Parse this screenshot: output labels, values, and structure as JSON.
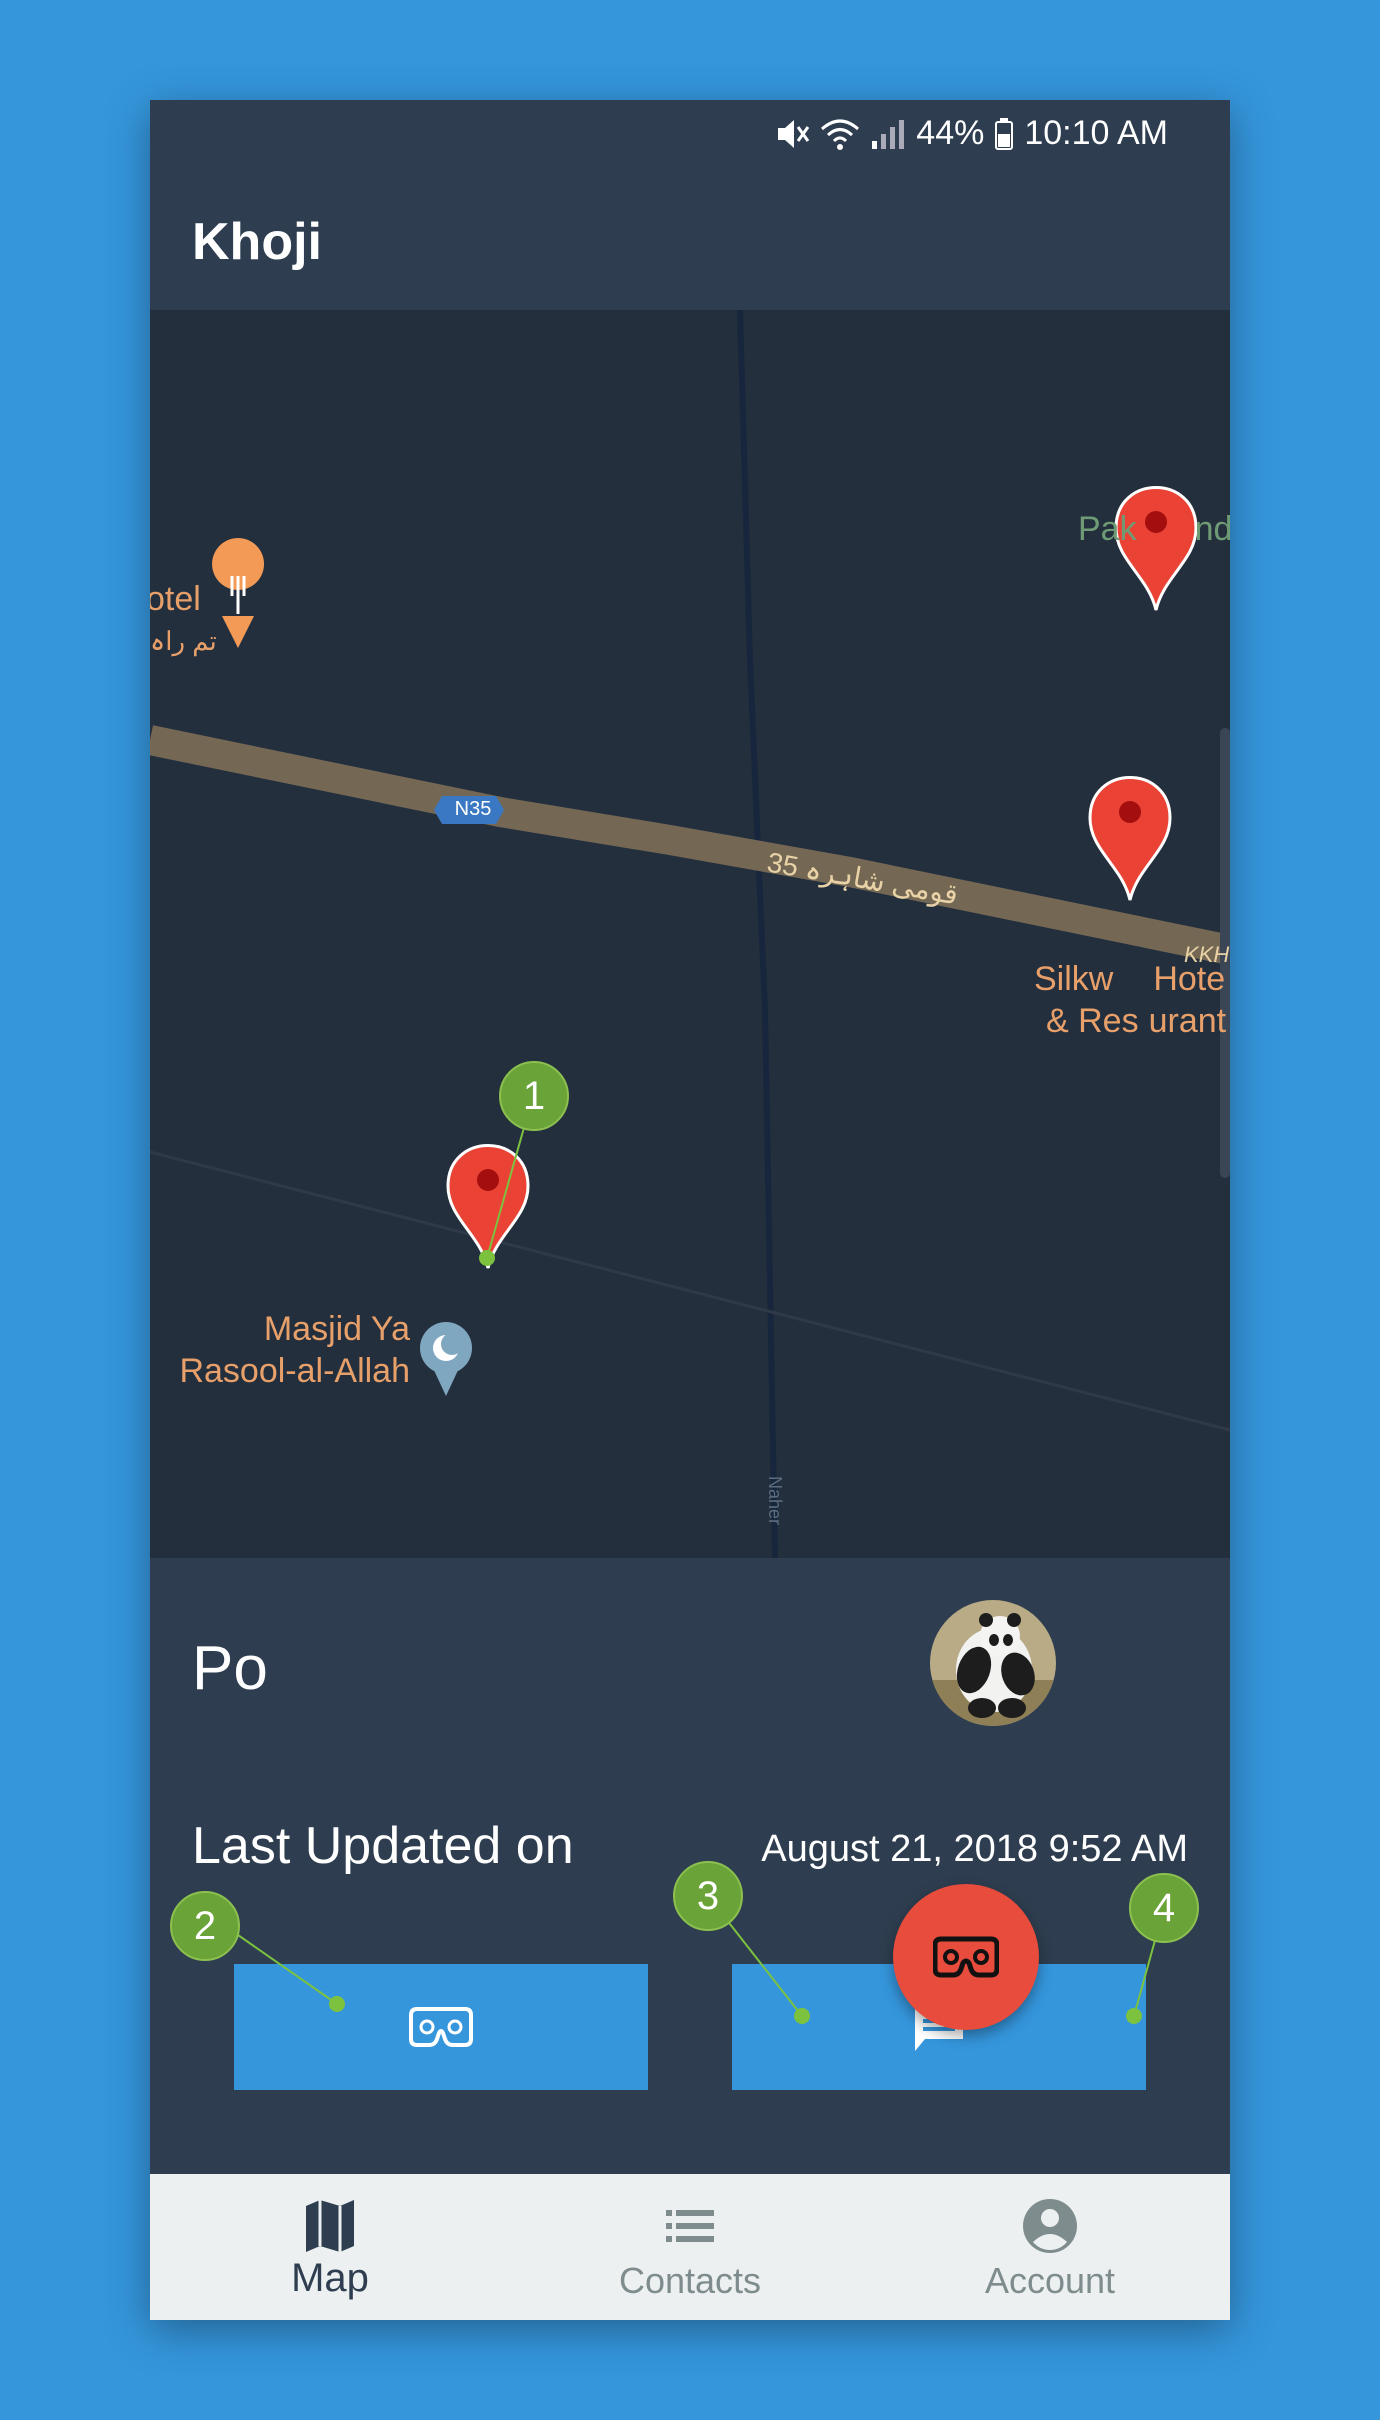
{
  "status_bar": {
    "battery": "44%",
    "time": "10:10 AM"
  },
  "app": {
    "title": "Khoji"
  },
  "map": {
    "labels": {
      "hotel_en": "otel",
      "hotel_ur": "تم راہ",
      "road_shield": "N35",
      "road_name": "قومی شاہرہ 35",
      "top_right": "Pak",
      "top_right_tail": "nd",
      "kkh": "KKH",
      "silk_1": "Silkw",
      "silk_1_tail": "Hote",
      "silk_2": "& Res",
      "silk_2_tail": "urant",
      "masjid_1": "Masjid Ya",
      "masjid_2": "Rasool-al-Allah",
      "naher": "Naher"
    },
    "colors": {
      "background": "#242f3e",
      "road": "#746855",
      "marker": "#ea4335"
    }
  },
  "profile": {
    "name": "Po",
    "last_updated_label": "Last Updated on",
    "last_updated_value": "August 21, 2018 9:52 AM"
  },
  "buttons": {
    "vr_button_icon": "vr-headset-icon",
    "message_button_icon": "chat-icon",
    "fab_icon": "vr-headset-icon"
  },
  "annotations": [
    "1",
    "2",
    "3",
    "4"
  ],
  "nav": [
    {
      "label": "Map",
      "icon": "map-icon",
      "active": true
    },
    {
      "label": "Contacts",
      "icon": "list-icon",
      "active": false
    },
    {
      "label": "Account",
      "icon": "account-circle-icon",
      "active": false
    }
  ],
  "colors": {
    "primary": "#2e3e50",
    "accent": "#3596dc",
    "fab": "#e74c3c",
    "badge": "#6aa338"
  }
}
